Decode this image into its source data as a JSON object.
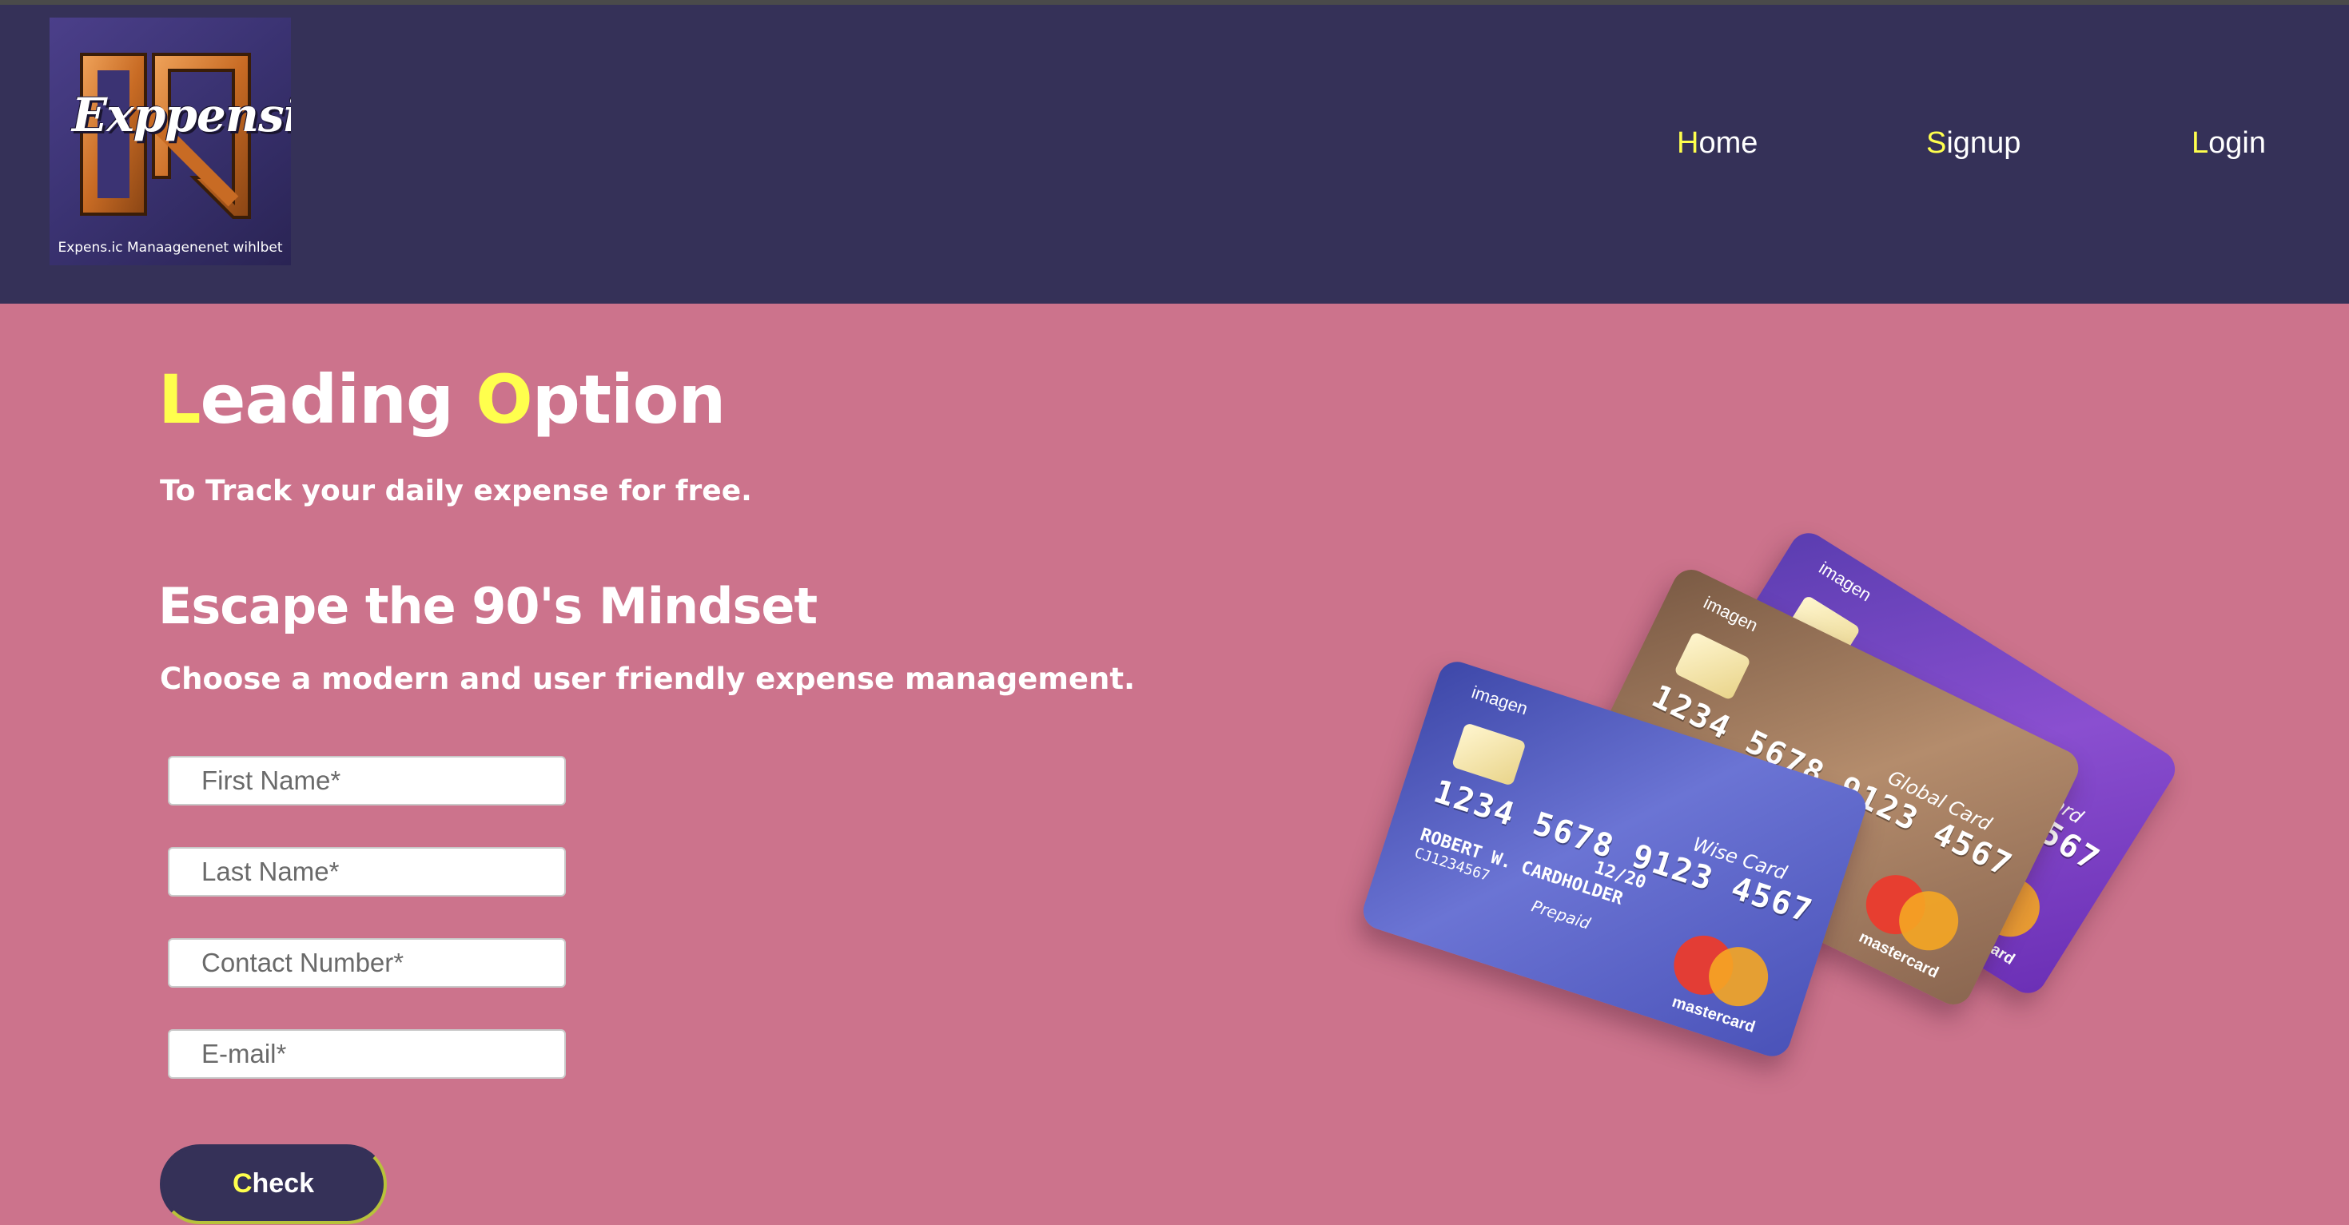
{
  "nav": {
    "logo_word": "Exppensio",
    "logo_tagline": "Expens.ic Manaagenenet wihlbet",
    "links": [
      {
        "first": "H",
        "rest": "ome"
      },
      {
        "first": "S",
        "rest": "ignup"
      },
      {
        "first": "L",
        "rest": "ogin"
      }
    ]
  },
  "hero": {
    "title_parts": [
      "L",
      "eading ",
      "O",
      "ption"
    ],
    "subtitle": "To Track your daily expense for free.",
    "heading2": "Escape the 90's Mindset",
    "subtitle2": "Choose a modern and user friendly expense management."
  },
  "form": {
    "first_name_placeholder": "First Name*",
    "last_name_placeholder": "Last Name*",
    "contact_placeholder": "Contact Number*",
    "email_placeholder": "E-mail*",
    "check_first": "C",
    "check_rest": "heck"
  },
  "cards": {
    "back": {
      "brand": "imagen",
      "number": "1234 5678 9123 4567",
      "label": "Pay Card",
      "network": "mastercard"
    },
    "middle": {
      "brand": "imagen",
      "number": "1234 5678 9123 4567",
      "label": "Global Card",
      "network": "mastercard"
    },
    "front": {
      "brand": "imagen",
      "number": "1234 5678 9123 4567",
      "label": "Wise Card",
      "holder": "ROBERT W. CARDHOLDER",
      "account": "CJ1234567",
      "valid": "12/20",
      "type": "Prepaid",
      "network": "mastercard"
    },
    "colors": {
      "front": "#4f56b8",
      "middle": "#a07a62",
      "back": "#7b3fc2"
    }
  },
  "colors": {
    "nav_bg": "#353158",
    "page_bg": "#cc738c",
    "accent": "#ffff4d"
  }
}
